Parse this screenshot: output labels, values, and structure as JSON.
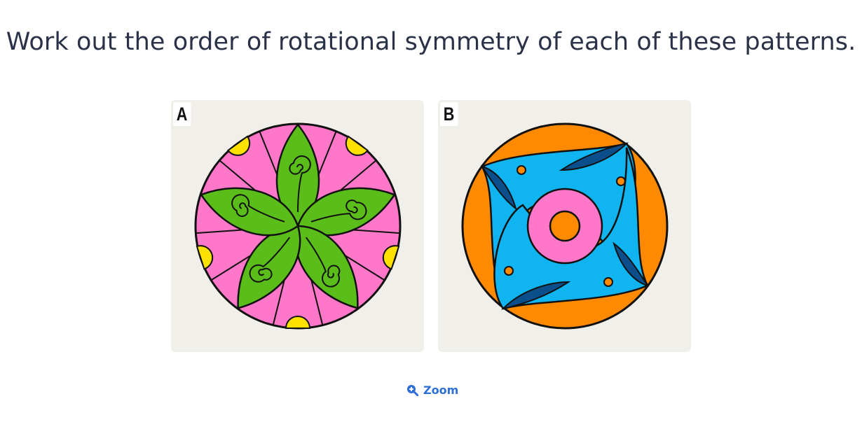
{
  "question": "Work out the order of rotational symmetry of each of these patterns.",
  "patterns": [
    {
      "label": "A"
    },
    {
      "label": "B"
    }
  ],
  "zoom": {
    "label": "Zoom",
    "icon": "zoom-in-icon"
  },
  "colors": {
    "card_bg": "#f1efe9",
    "pink": "#ff77c8",
    "green": "#5bbd1a",
    "yellow": "#ffe100",
    "orange": "#ff8a00",
    "light_blue": "#10b4f0",
    "dark_blue": "#0a4f8c",
    "zoom_blue": "#2d6fd6"
  }
}
